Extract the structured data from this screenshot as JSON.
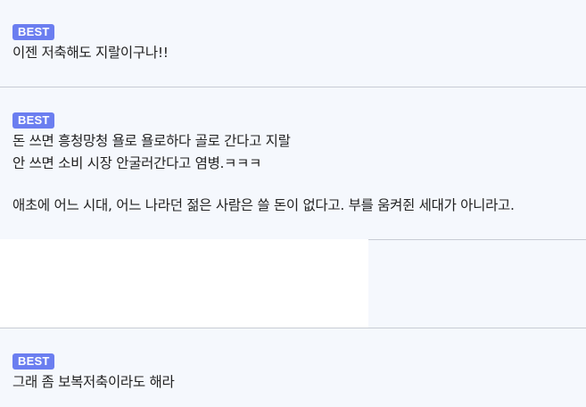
{
  "comments": [
    {
      "badge": "BEST",
      "lines": [
        "이젠 저축해도 지랄이구나!!"
      ]
    },
    {
      "badge": "BEST",
      "lines": [
        "돈 쓰면 흥청망청 욜로 욜로하다 골로 간다고 지랄",
        "안 쓰면 소비 시장 안굴러간다고 염병.ㅋㅋㅋ",
        "",
        "애초에 어느 시대, 어느 나라던 젊은 사람은 쓸 돈이 없다고. 부를 움켜쥔 세대가 아니라고."
      ]
    },
    {
      "badge": "BEST",
      "lines": [
        "그래 좀 보복저축이라도 해라"
      ]
    }
  ]
}
